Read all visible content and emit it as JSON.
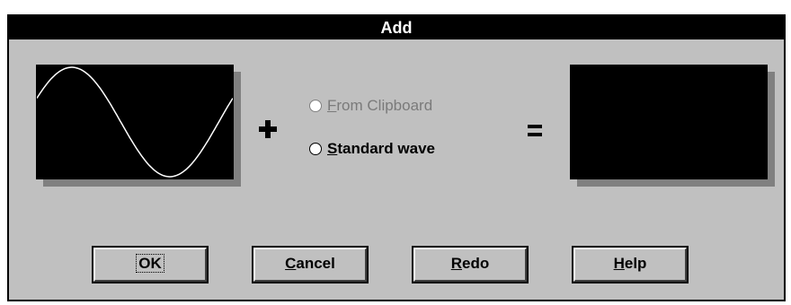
{
  "dialog": {
    "title": "Add"
  },
  "options": {
    "from_clipboard": {
      "accel": "F",
      "rest": "rom Clipboard",
      "enabled": false,
      "selected": false
    },
    "standard_wave": {
      "accel": "S",
      "rest": "tandard wave",
      "enabled": true,
      "selected": false
    }
  },
  "buttons": {
    "ok": {
      "label": "OK",
      "focused": true
    },
    "cancel": {
      "accel": "C",
      "rest": "ancel"
    },
    "redo": {
      "accel": "R",
      "rest": "edo"
    },
    "help": {
      "accel": "H",
      "rest": "elp"
    }
  },
  "colors": {
    "face": "#c0c0c0",
    "title_bg": "#000000",
    "display_bg": "#000000",
    "wave": "#ffffff"
  },
  "icons": {
    "plus": "plus-icon",
    "equals": "equals-icon"
  }
}
